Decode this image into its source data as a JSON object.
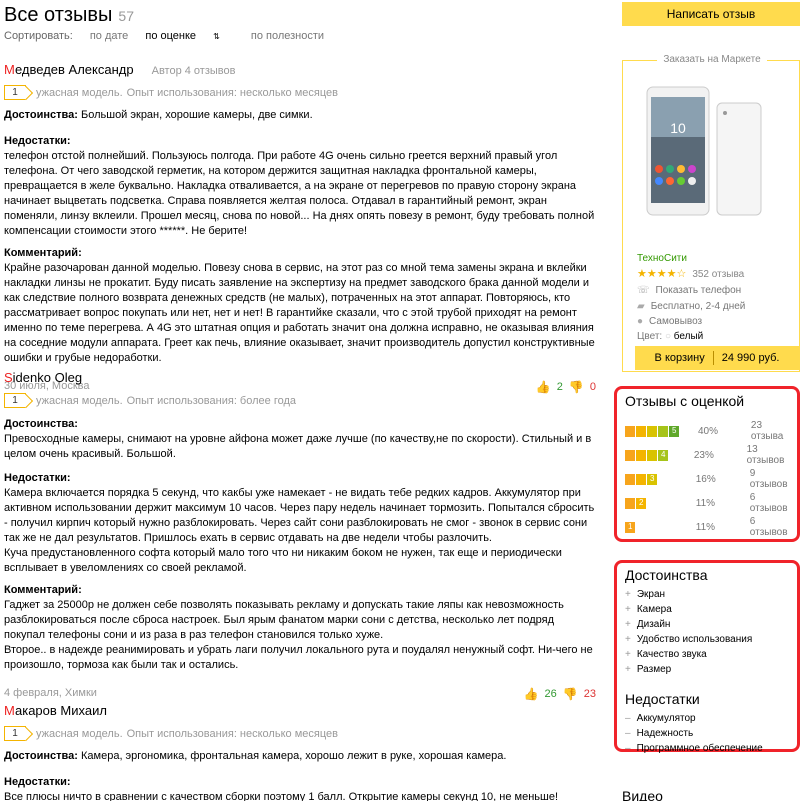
{
  "header": {
    "title": "Все отзывы",
    "count": "57"
  },
  "sort": {
    "label": "Сортировать:",
    "by_date": "по дате",
    "by_rating": "по оценке",
    "by_usefulness": "по полезности"
  },
  "reviews": [
    {
      "initial": "М",
      "name_rest": "едведев Александр",
      "meta": "Автор 4 отзывов",
      "grade": "1",
      "grade_text": "ужасная модель.",
      "experience": "Опыт использования: несколько месяцев",
      "pros_title": "Достоинства:",
      "pros": "Большой экран, хорошие камеры, две симки.",
      "cons_title": "Недостатки:",
      "cons": "телефон отстой полнейший. Пользуюсь полгода. При работе 4G очень сильно греется верхний правый угол телефона. От чего заводской герметик, на котором держится защитная накладка фронтальной камеры, превращается в желе буквально. Накладка отваливается, а на экране от перегревов по правую сторону экрана начинает выцветать подсветка. Справа появляется желтая полоса. Отдавал в гарантийный ремонт, экран поменяли, линзу вклеили. Прошел месяц, снова по новой... На днях опять повезу в ремонт, буду требовать полной компенсации стоимости этого ******. Не берите!",
      "comment_title": "Комментарий:",
      "comment": "Крайне разочарован данной моделью. Повезу снова в сервис, на этот раз со мной тема замены экрана и вклейки накладки линзы не прокатит. Буду писать заявление на экспертизу на предмет заводского брака данной модели и как следствие полного возврата денежных средств (не малых), потраченных на этот аппарат. Повторяюсь, кто рассматривает вопрос покупать или нет, нет и нет! В гарантийке сказали, что с этой трубой приходят на ремонт именно по теме перегрева. А 4G это штатная опция и работать значит она должна исправно, не оказывая влияния на соседние модули аппарата. Греет как печь, влияние оказывает, значит производитель допустил конструктивные ошибки и грубые недоработки.",
      "date": "30 июля, Москва",
      "up": "2",
      "down": "0"
    },
    {
      "initial": "S",
      "name_rest": "idenko Oleg",
      "meta": "",
      "grade": "1",
      "grade_text": "ужасная модель.",
      "experience": "Опыт использования: более года",
      "pros_title": "Достоинства:",
      "pros": "Превосходные камеры, снимают на уровне айфона может даже лучше (по качеству,не по скорости). Стильный и в целом очень красивый. Большой.",
      "cons_title": "Недостатки:",
      "cons": "Камера включается порядка 5 секунд, что какбы уже намекает - не видать тебе редких кадров. Аккумулятор при активном использовании держит максимум 10 часов. Через пару недель начинает тормозить. Попытался сбросить - получил кирпич который нужно разблокировать. Через сайт сони разблокировать не смог - звонок в сервис сони так же не дал результатов. Пришлось ехать в сервис отдавать на две недели чтобы разлочить.\nКуча предустановленного софта который мало того что ни никаким боком не нужен, так еще и периодически всплывает в увеломлениях со своей рекламой.",
      "comment_title": "Комментарий:",
      "comment": "Гаджет за 25000р не должен себе позволять показывать рекламу и допускать такие ляпы как невозможность разблокироваться после сброса настроек. Был ярым фанатом марки сони с детства, несколько лет подряд покупал телефоны сони и из раза в раз телефон становился только хуже.\nВторое.. в надежде реанимировать и убрать лаги получил локального рута и поудалял ненужный софт. Ни-чего не произошло, тормоза как были так и остались.",
      "date": "4 февраля, Химки",
      "up": "26",
      "down": "23"
    },
    {
      "initial": "М",
      "name_rest": "акаров Михаил",
      "meta": "",
      "grade": "1",
      "grade_text": "ужасная модель.",
      "experience": "Опыт использования: несколько месяцев",
      "pros_title": "Достоинства:",
      "pros": "Камера, эргономика, фронтальная камера, хорошо лежит в руке, хорошая камера.",
      "cons_title": "Недостатки:",
      "cons": "Все плюсы ничто в сравнении с качеством сборки поэтому 1 балл. Открытие камеры секунд 10, не меньше! Задняя поверхность"
    }
  ],
  "sidebar": {
    "write_button": "Написать отзыв",
    "offer": {
      "header": "Заказать на Маркете",
      "phone_time": "10",
      "shop": "ТехноСити",
      "stars": "★★★★☆",
      "rating_count": "352 отзыва",
      "show_phone": "Показать телефон",
      "delivery": "Бесплатно, 2-4 дней",
      "pickup": "Самовывоз",
      "color_label": "Цвет:",
      "color_value": "белый",
      "cart_label": "В корзину",
      "price": "24 990 руб."
    },
    "ratings": {
      "title": "Отзывы с оценкой",
      "rows": [
        {
          "grade": "5",
          "pct": "40%",
          "count": "23 отзыва"
        },
        {
          "grade": "4",
          "pct": "23%",
          "count": "13 отзывов"
        },
        {
          "grade": "3",
          "pct": "16%",
          "count": "9 отзывов"
        },
        {
          "grade": "2",
          "pct": "11%",
          "count": "6 отзывов"
        },
        {
          "grade": "1",
          "pct": "11%",
          "count": "6 отзывов"
        }
      ]
    },
    "pros_title": "Достоинства",
    "pros": [
      "Экран",
      "Камера",
      "Дизайн",
      "Удобство использования",
      "Качество звука",
      "Размер"
    ],
    "cons_title": "Недостатки",
    "cons": [
      "Аккумулятор",
      "Надежность",
      "Программное обеспечение"
    ],
    "video_title": "Видео"
  },
  "colors": {
    "accent": "#ffdb4d",
    "highlight": "#f0232a",
    "shop_green": "#339900"
  }
}
